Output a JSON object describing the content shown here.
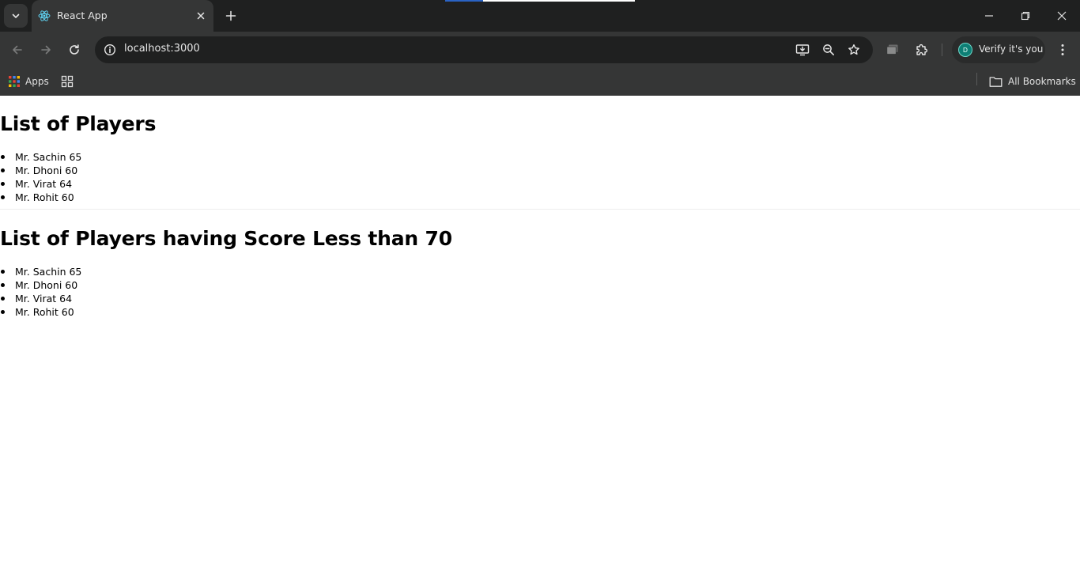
{
  "browser": {
    "tab": {
      "title": "React App",
      "favicon": "react-logo-icon"
    },
    "load_progress_fraction": 0.2,
    "address_bar": {
      "url": "localhost:3000"
    },
    "profile": {
      "initial": "D",
      "label": "Verify it's you",
      "avatar_color": "#0d7f75"
    },
    "bookmarks": {
      "apps_label": "Apps",
      "all_bookmarks_label": "All Bookmarks"
    },
    "colors": {
      "titlebar": "#1f2020",
      "toolbar": "#353636",
      "accent": "#2a63c4"
    }
  },
  "page": {
    "sections": [
      {
        "heading": "List of Players",
        "players": [
          "Mr. Sachin 65",
          "Mr. Dhoni 60",
          "Mr. Virat 64",
          "Mr. Rohit 60"
        ]
      },
      {
        "heading": "List of Players having Score Less than 70",
        "players": [
          "Mr. Sachin 65",
          "Mr. Dhoni 60",
          "Mr. Virat 64",
          "Mr. Rohit 60"
        ]
      }
    ]
  }
}
